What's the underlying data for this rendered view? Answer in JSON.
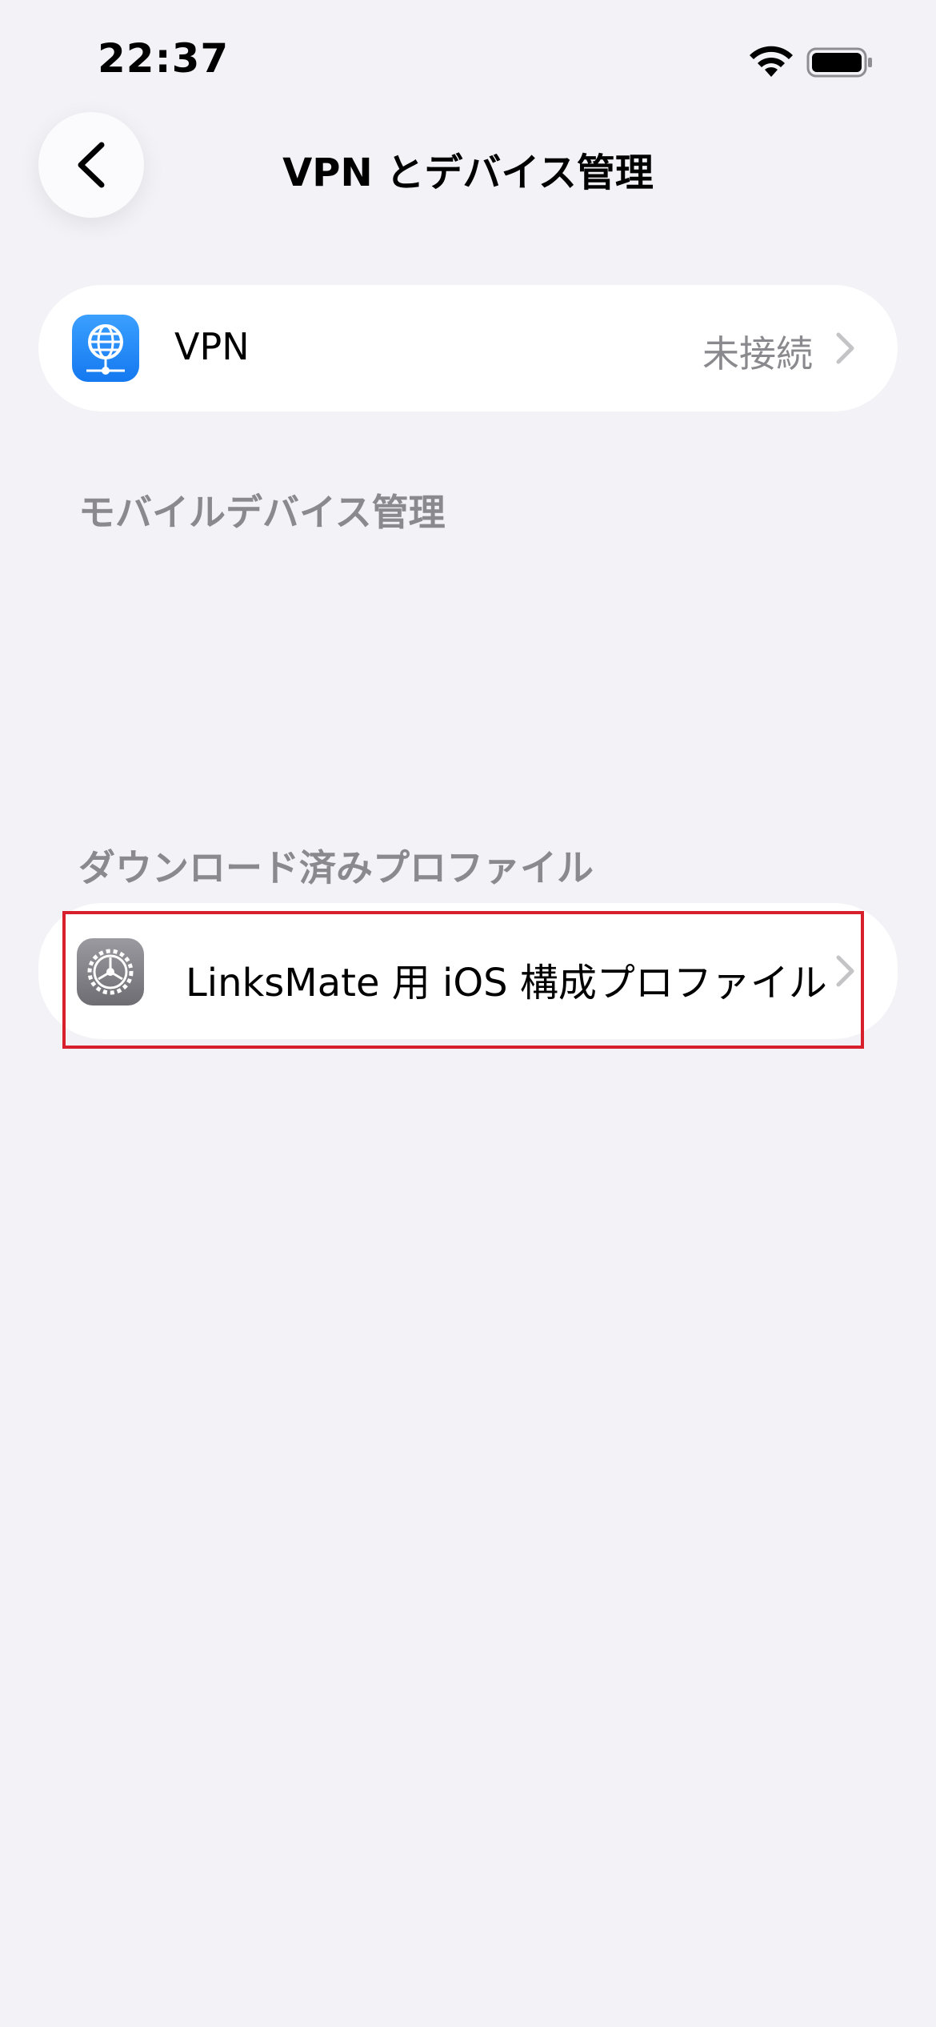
{
  "status_bar": {
    "time": "22:37",
    "icons": [
      "wifi-icon",
      "battery-icon"
    ]
  },
  "nav": {
    "title": "VPN とデバイス管理",
    "back_icon": "chevron-left-icon"
  },
  "vpn_row": {
    "icon": "globe-network-icon",
    "label": "VPN",
    "status": "未接続"
  },
  "sections": {
    "mdm_header": "モバイルデバイス管理",
    "downloaded_header": "ダウンロード済みプロファイル"
  },
  "profile_row": {
    "icon": "gear-icon",
    "label": "LinksMate 用 iOS 構成プロファイル"
  },
  "colors": {
    "background": "#f2f2f7",
    "vpn_icon": "#1e88ff",
    "highlight": "#d8202c",
    "secondary_text": "#8a8a8e"
  }
}
